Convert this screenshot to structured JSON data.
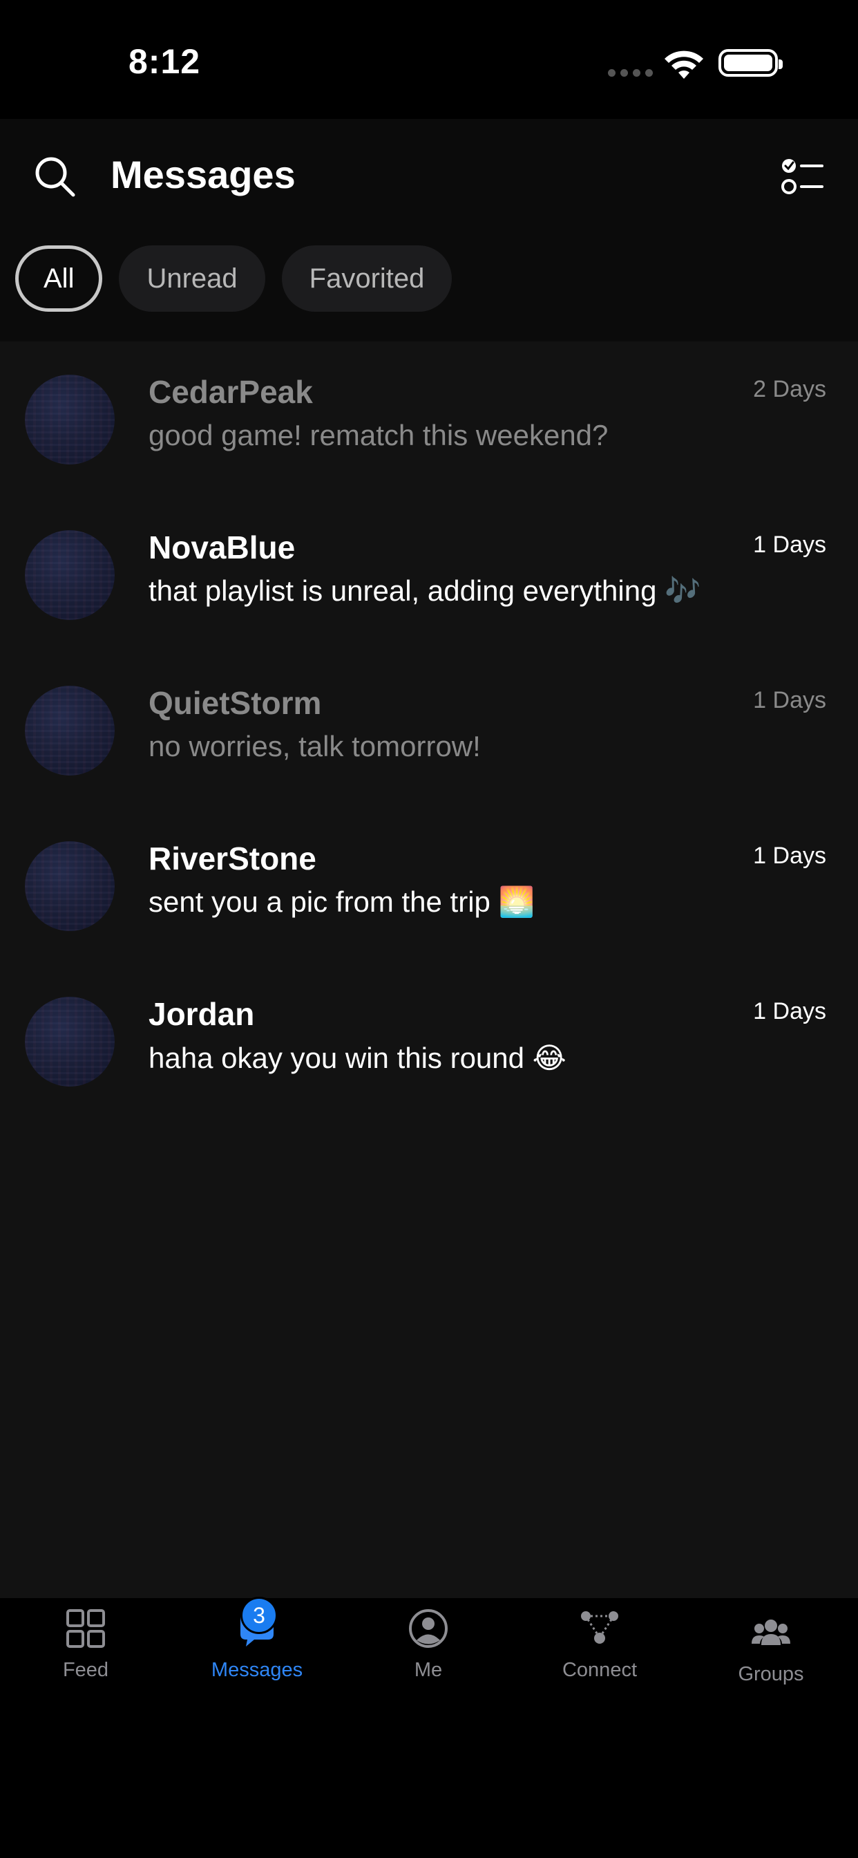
{
  "status_bar": {
    "time": "8:12"
  },
  "header": {
    "title": "Messages",
    "icons": {
      "search": "search-icon",
      "filter": "checklist-icon"
    },
    "filters": [
      {
        "label": "All",
        "active": true
      },
      {
        "label": "Unread",
        "active": false
      },
      {
        "label": "Favorited",
        "active": false
      }
    ]
  },
  "conversations": [
    {
      "name": "CedarPeak",
      "preview": "good game! rematch this weekend?",
      "time": "2 Days",
      "unread": false
    },
    {
      "name": "NovaBlue",
      "preview": "that playlist is unreal, adding everything 🎶",
      "time": "1 Days",
      "unread": true
    },
    {
      "name": "QuietStorm",
      "preview": "no worries, talk tomorrow!",
      "time": "1 Days",
      "unread": false
    },
    {
      "name": "RiverStone",
      "preview": "sent you a pic from the trip 🌅",
      "time": "1 Days",
      "unread": true
    },
    {
      "name": "Jordan",
      "preview": "haha okay you win this round 😂",
      "time": "1 Days",
      "unread": true
    }
  ],
  "tabbar": {
    "tabs": [
      {
        "label": "Feed",
        "icon": "grid-icon",
        "active": false
      },
      {
        "label": "Messages",
        "icon": "chat-bubble-icon",
        "active": true,
        "badge": "3"
      },
      {
        "label": "Me",
        "icon": "profile-icon",
        "active": false
      },
      {
        "label": "Connect",
        "icon": "network-icon",
        "active": false
      },
      {
        "label": "Groups",
        "icon": "group-icon",
        "active": false
      }
    ]
  },
  "colors": {
    "accent": "#2f86f6",
    "badge": "#1a7cf0",
    "list_bg": "#121212",
    "header_bg": "#0b0b0b"
  }
}
